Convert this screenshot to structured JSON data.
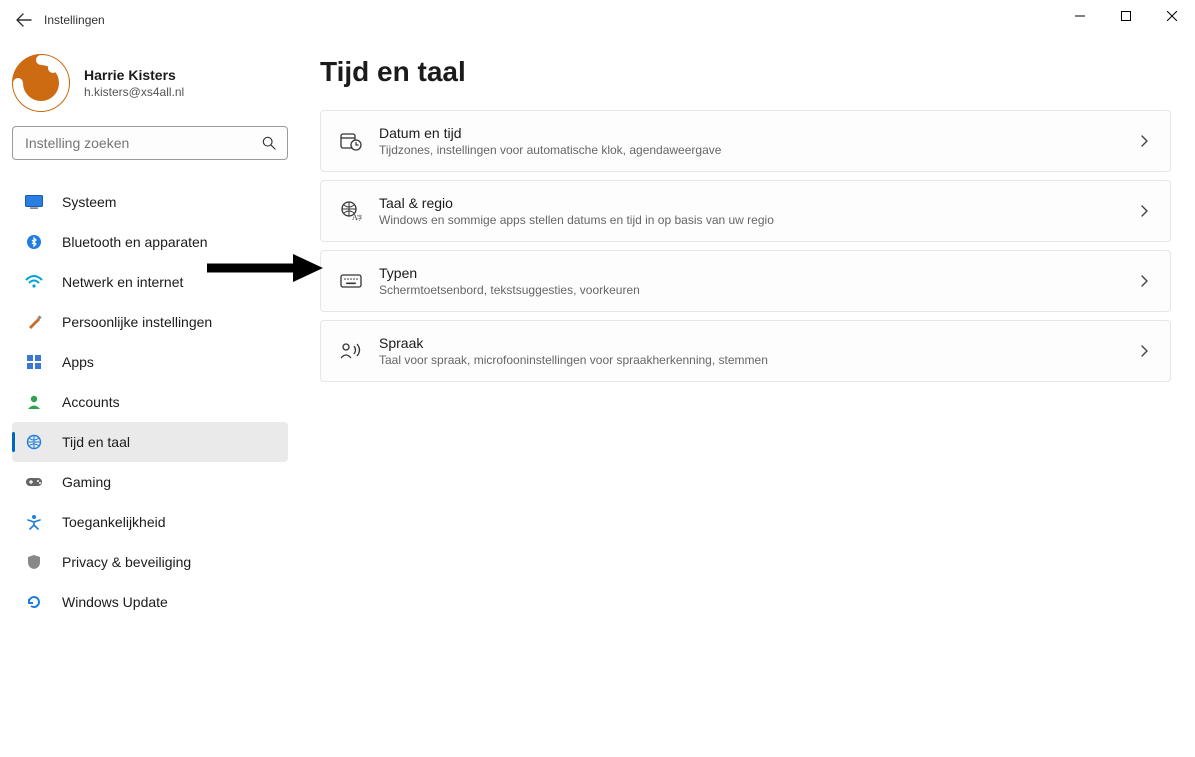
{
  "window": {
    "title": "Instellingen"
  },
  "user": {
    "name": "Harrie Kisters",
    "email": "h.kisters@xs4all.nl"
  },
  "search": {
    "placeholder": "Instelling zoeken"
  },
  "nav": {
    "items": [
      {
        "label": "Systeem"
      },
      {
        "label": "Bluetooth en apparaten"
      },
      {
        "label": "Netwerk en internet"
      },
      {
        "label": "Persoonlijke instellingen"
      },
      {
        "label": "Apps"
      },
      {
        "label": "Accounts"
      },
      {
        "label": "Tijd en taal"
      },
      {
        "label": "Gaming"
      },
      {
        "label": "Toegankelijkheid"
      },
      {
        "label": "Privacy & beveiliging"
      },
      {
        "label": "Windows Update"
      }
    ],
    "active_index": 6
  },
  "main": {
    "title": "Tijd en taal",
    "cards": [
      {
        "title": "Datum en tijd",
        "subtitle": "Tijdzones, instellingen voor automatische klok, agendaweergave"
      },
      {
        "title": "Taal & regio",
        "subtitle": "Windows en sommige apps stellen datums en tijd in op basis van uw regio"
      },
      {
        "title": "Typen",
        "subtitle": "Schermtoetsenbord, tekstsuggesties, voorkeuren"
      },
      {
        "title": "Spraak",
        "subtitle": "Taal voor spraak, microfooninstellingen voor spraakherkenning, stemmen"
      }
    ]
  },
  "annotation": {
    "target_card_index": 1
  }
}
